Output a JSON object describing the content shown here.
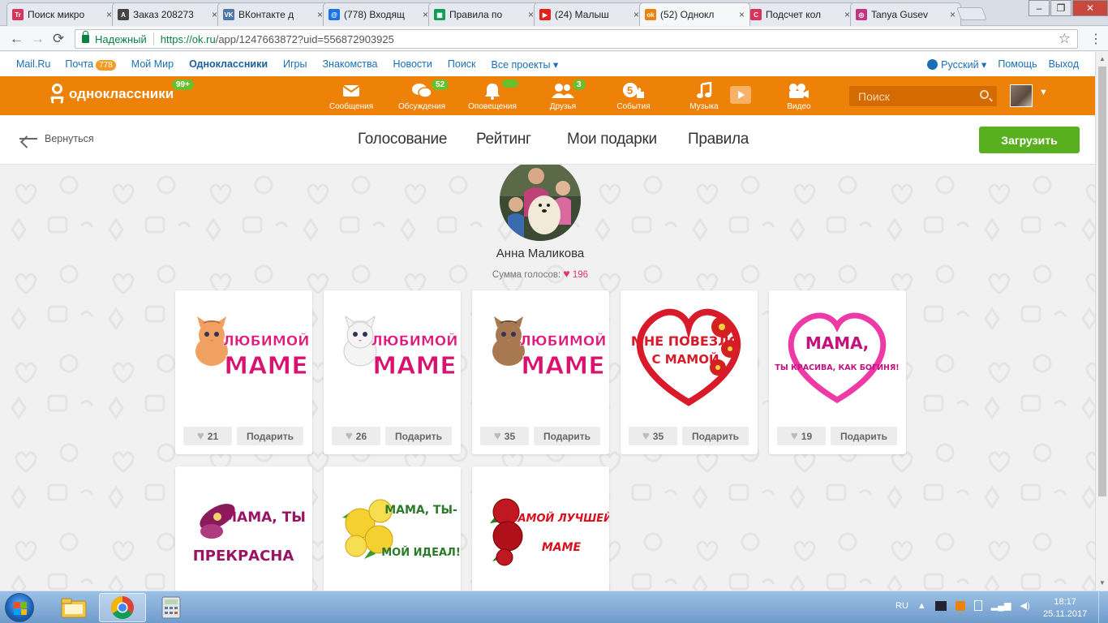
{
  "browser": {
    "tabs": [
      {
        "title": "Поиск микро",
        "fav_color": "#d9345a",
        "fav_text": "Tr"
      },
      {
        "title": "Заказ 208273",
        "fav_color": "#444444",
        "fav_text": "A"
      },
      {
        "title": "ВКонтакте д",
        "fav_color": "#4a76a8",
        "fav_text": "VK"
      },
      {
        "title": "(778) Входящ",
        "fav_color": "#1a73e8",
        "fav_text": "@"
      },
      {
        "title": "Правила по",
        "fav_color": "#0f9d58",
        "fav_text": "▦"
      },
      {
        "title": "(24) Малыш",
        "fav_color": "#e62117",
        "fav_text": "▶"
      },
      {
        "title": "(52) Однокл",
        "fav_color": "#ee8208",
        "fav_text": "ok"
      },
      {
        "title": "Подсчет кол",
        "fav_color": "#d9345a",
        "fav_text": "C"
      },
      {
        "title": "Tanya Gusev",
        "fav_color": "#c13584",
        "fav_text": "◎"
      }
    ],
    "secure_label": "Надежный",
    "url_host": "https://ok.ru",
    "url_rest": "/app/1247663872?uid=556872903925"
  },
  "mailbar": {
    "left": [
      "Mail.Ru",
      "Почта",
      "Мой Мир",
      "Одноклассники",
      "Игры",
      "Знакомства",
      "Новости",
      "Поиск",
      "Все проекты"
    ],
    "mail_count": "778",
    "language": "Русский",
    "help": "Помощь",
    "logout": "Выход"
  },
  "okheader": {
    "logo_text": "одноклассники",
    "logo_badge": "99+",
    "tools": [
      {
        "label": "Сообщения",
        "icon": "envelope-icon",
        "badge": ""
      },
      {
        "label": "Обсуждения",
        "icon": "chat-bubbles-icon",
        "badge": "52"
      },
      {
        "label": "Оповещения",
        "icon": "bell-icon",
        "badge": " "
      },
      {
        "label": "Друзья",
        "icon": "friends-icon",
        "badge": "3"
      },
      {
        "label": "События",
        "icon": "events-icon",
        "badge": ""
      },
      {
        "label": "Музыка",
        "icon": "music-note-icon",
        "badge": ""
      },
      {
        "label": "Видео",
        "icon": "video-camera-icon",
        "badge": ""
      }
    ],
    "search_placeholder": "Поиск"
  },
  "app": {
    "back_label": "Вернуться",
    "nav": [
      "Голосование",
      "Рейтинг",
      "Мои подарки",
      "Правила"
    ],
    "upload_label": "Загрузить"
  },
  "profile": {
    "name": "Анна Маликова",
    "votes_label": "Сумма голосов:",
    "votes_value": "196"
  },
  "gifts": [
    {
      "line1": "ЛЮБИМОЙ",
      "line2": "МАМЕ",
      "likes": "21",
      "gift_label": "Подарить",
      "art": "kitten-orange"
    },
    {
      "line1": "ЛЮБИМОЙ",
      "line2": "МАМЕ",
      "likes": "26",
      "gift_label": "Подарить",
      "art": "kitten-white"
    },
    {
      "line1": "ЛЮБИМОЙ",
      "line2": "МАМЕ",
      "likes": "35",
      "gift_label": "Подарить",
      "art": "kitten-brown"
    },
    {
      "line1": "МНЕ ПОВЕЗЛО",
      "line2": "С МАМОЙ",
      "likes": "35",
      "gift_label": "Подарить",
      "art": "heart-red"
    },
    {
      "line1": "МАМА,",
      "line2": "ТЫ КРАСИВА, КАК БОГИНЯ!",
      "likes": "19",
      "gift_label": "Подарить",
      "art": "heart-pink"
    },
    {
      "line1": "МАМА, ТЫ",
      "line2": "ПРЕКРАСНА",
      "art": "brooch"
    },
    {
      "line1": "МАМА, ТЫ-",
      "line2": "МОЙ ИДЕАЛ!",
      "art": "yellow-roses"
    },
    {
      "line1": "САМОЙ ЛУЧШЕЙ",
      "line2": "МАМЕ",
      "art": "red-roses"
    }
  ],
  "taskbar": {
    "lang": "RU",
    "time": "18:17",
    "date": "25.11.2017"
  },
  "colors": {
    "ok_orange": "#ee8208",
    "upload_green": "#58b01e",
    "badge_green": "#69c02c",
    "heart_pink": "#e6336e"
  }
}
